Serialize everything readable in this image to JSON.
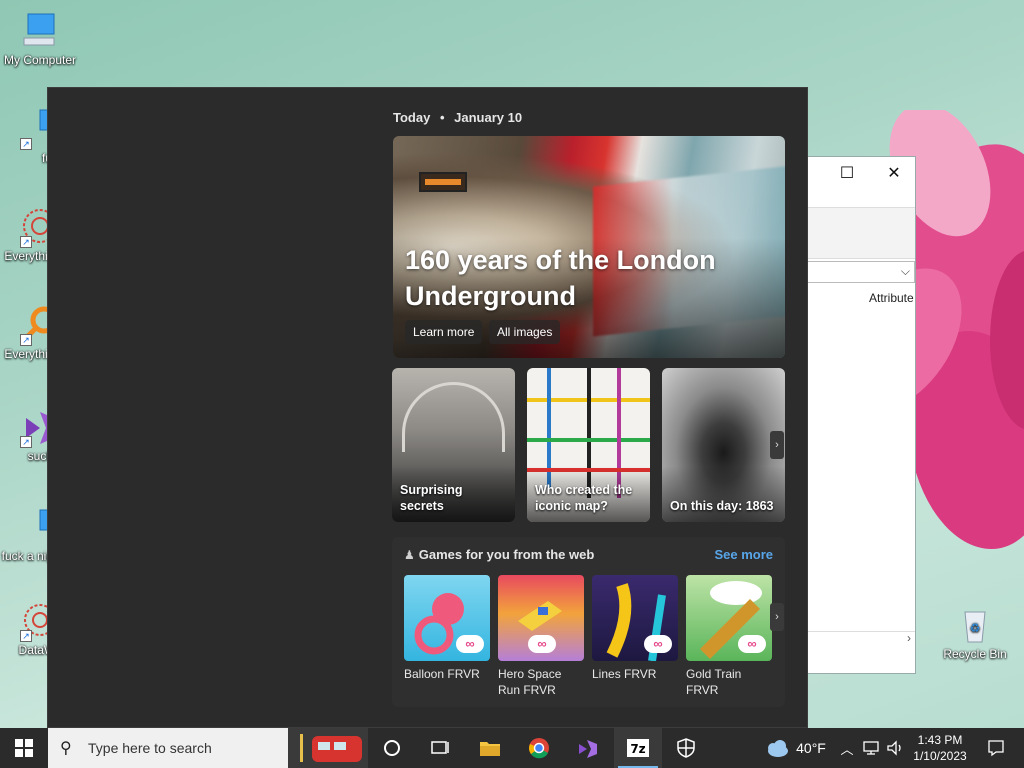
{
  "desktop": {
    "icons": [
      {
        "label": "My Computer"
      },
      {
        "label": "fuck"
      },
      {
        "label": "Everythi suck"
      },
      {
        "label": "Everythi suck"
      },
      {
        "label": "suck"
      },
      {
        "label": "fuck a nigga ki"
      },
      {
        "label": "DataWa"
      },
      {
        "label": "Recycle Bin"
      }
    ]
  },
  "background_window": {
    "column_header": "Attribute"
  },
  "widgets": {
    "date_prefix": "Today",
    "date_sep": "•",
    "date": "January 10",
    "hero": {
      "title": "160 years of the London Underground",
      "learn_more": "Learn more",
      "all_images": "All images"
    },
    "cards": [
      {
        "caption": "Surprising secrets"
      },
      {
        "caption": "Who created the iconic map?"
      },
      {
        "caption": "On this day: 1863"
      }
    ],
    "games": {
      "heading": "Games for you from the web",
      "see_more": "See more",
      "items": [
        {
          "name": "Balloon FRVR"
        },
        {
          "name": "Hero Space Run FRVR"
        },
        {
          "name": "Lines FRVR"
        },
        {
          "name": "Gold Train FRVR"
        }
      ]
    }
  },
  "taskbar": {
    "search_placeholder": "Type here to search",
    "weather": "40°F",
    "time": "1:43 PM",
    "date": "1/10/2023",
    "apps": [
      "cortana",
      "task-view",
      "file-explorer",
      "chrome",
      "visual-studio",
      "7zip",
      "security"
    ]
  },
  "colors": {
    "accent": "#58a6ea",
    "panel": "#2b2b2b",
    "taskbar": "#2b2b2b"
  }
}
